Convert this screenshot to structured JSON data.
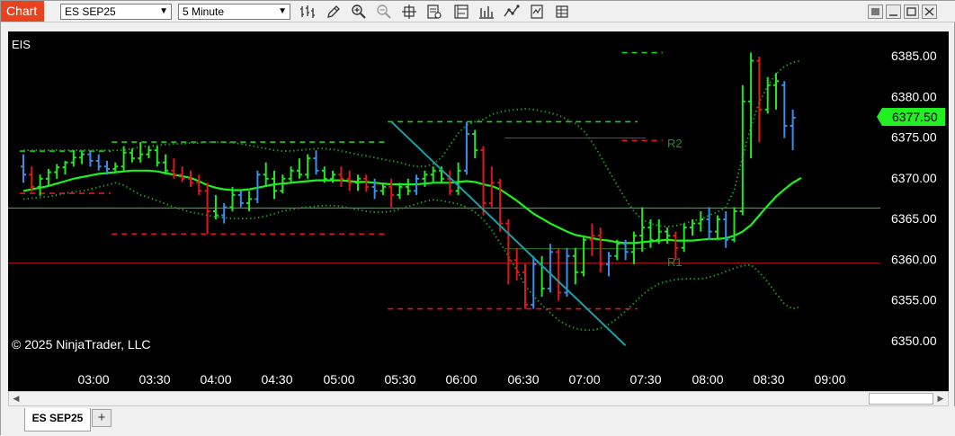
{
  "window": {
    "tag": "Chart",
    "instrument": "ES SEP25",
    "timeframe": "5 Minute"
  },
  "toolbar_icons": [
    "bar-style-icon",
    "draw-pencil-icon",
    "zoom-in-icon",
    "zoom-out-icon",
    "crosshair-icon",
    "data-box-icon",
    "strategies-icon",
    "indicators-icon",
    "chart-trader-icon",
    "properties-icon",
    "templates-icon"
  ],
  "chart": {
    "symbol_label": "EIS",
    "copyright": "© 2025 NinjaTrader, LLC",
    "level_labels": [
      "R2",
      "R1"
    ],
    "current_price": "6377.50",
    "price_ticks": [
      "6385.00",
      "6380.00",
      "6375.00",
      "6370.00",
      "6365.00",
      "6360.00",
      "6355.00",
      "6350.00"
    ],
    "time_ticks": [
      "03:00",
      "03:30",
      "04:00",
      "04:30",
      "05:00",
      "05:30",
      "06:00",
      "06:30",
      "07:00",
      "07:30",
      "08:00",
      "08:30",
      "09:00"
    ],
    "colors": {
      "up_bar": "#22e822",
      "down_bar": "#e01818",
      "neutral_bar": "#3a8eea",
      "sma": "#1ef01e",
      "band": "#1f8f1f",
      "trendline": "#1aa0a8",
      "price_box": "#22f022"
    }
  },
  "chart_data": {
    "type": "candlestick-ohlc",
    "title": "",
    "symbol": "ES SEP25",
    "interval": "5 Minute",
    "ylim": [
      6348,
      6388
    ],
    "y_ticks": [
      6350,
      6355,
      6360,
      6365,
      6370,
      6375,
      6380,
      6385
    ],
    "x_ticks": [
      "03:00",
      "03:30",
      "04:00",
      "04:30",
      "05:00",
      "05:30",
      "06:00",
      "06:30",
      "07:00",
      "07:30",
      "08:00",
      "08:30",
      "09:00"
    ],
    "bars": [
      [
        6371.4,
        6372.9,
        6369.4,
        6370.4,
        "n"
      ],
      [
        6370.4,
        6371.4,
        6368.3,
        6368.9,
        "d"
      ],
      [
        6368.9,
        6370.4,
        6367.8,
        6369.9,
        "u"
      ],
      [
        6369.9,
        6371.1,
        6369.1,
        6370.7,
        "u"
      ],
      [
        6370.7,
        6371.7,
        6369.9,
        6371.3,
        "u"
      ],
      [
        6371.3,
        6372.1,
        6370.4,
        6371.9,
        "u"
      ],
      [
        6371.9,
        6373.4,
        6371.4,
        6372.5,
        "u"
      ],
      [
        6372.5,
        6373.2,
        6371.7,
        6372.9,
        "u"
      ],
      [
        6372.9,
        6373.3,
        6371.4,
        6372.1,
        "n"
      ],
      [
        6372.1,
        6372.9,
        6370.9,
        6371.4,
        "n"
      ],
      [
        6371.4,
        6372.1,
        6370.4,
        6371.1,
        "n"
      ],
      [
        6371.1,
        6371.9,
        6370.6,
        6371.4,
        "u"
      ],
      [
        6371.4,
        6373.9,
        6370.9,
        6373.1,
        "u"
      ],
      [
        6373.1,
        6373.6,
        6371.9,
        6372.4,
        "u"
      ],
      [
        6372.4,
        6374.4,
        6371.9,
        6372.9,
        "u"
      ],
      [
        6372.9,
        6373.9,
        6372.4,
        6373.4,
        "u"
      ],
      [
        6373.4,
        6373.9,
        6371.4,
        6371.9,
        "u"
      ],
      [
        6371.9,
        6372.9,
        6370.4,
        6370.9,
        "u"
      ],
      [
        6370.9,
        6372.4,
        6369.9,
        6370.4,
        "d"
      ],
      [
        6370.4,
        6371.4,
        6369.5,
        6369.9,
        "d"
      ],
      [
        6369.9,
        6370.9,
        6368.9,
        6369.4,
        "d"
      ],
      [
        6369.4,
        6370.4,
        6367.9,
        6368.4,
        "d"
      ],
      [
        6368.4,
        6369.4,
        6363.1,
        6365.9,
        "d"
      ],
      [
        6365.9,
        6367.9,
        6364.9,
        6365.4,
        "u"
      ],
      [
        6365.4,
        6366.9,
        6364.4,
        6366.4,
        "n"
      ],
      [
        6366.4,
        6368.9,
        6365.9,
        6367.9,
        "u"
      ],
      [
        6367.9,
        6368.4,
        6366.4,
        6366.9,
        "n"
      ],
      [
        6366.9,
        6368.4,
        6365.9,
        6367.4,
        "u"
      ],
      [
        6367.4,
        6370.9,
        6366.9,
        6370.4,
        "n"
      ],
      [
        6370.4,
        6371.9,
        6368.9,
        6369.9,
        "u"
      ],
      [
        6369.9,
        6370.9,
        6367.4,
        6368.4,
        "u"
      ],
      [
        6368.4,
        6370.4,
        6368.1,
        6369.9,
        "u"
      ],
      [
        6369.9,
        6371.4,
        6369.4,
        6370.9,
        "u"
      ],
      [
        6370.9,
        6372.4,
        6369.9,
        6370.4,
        "u"
      ],
      [
        6370.4,
        6372.9,
        6369.9,
        6372.4,
        "u"
      ],
      [
        6372.4,
        6373.4,
        6370.4,
        6370.9,
        "n"
      ],
      [
        6370.9,
        6371.4,
        6369.4,
        6369.9,
        "u"
      ],
      [
        6369.9,
        6370.9,
        6369.4,
        6370.4,
        "u"
      ],
      [
        6370.4,
        6371.4,
        6368.9,
        6369.9,
        "d"
      ],
      [
        6369.9,
        6370.9,
        6368.4,
        6369.4,
        "d"
      ],
      [
        6369.4,
        6370.4,
        6368.4,
        6369.9,
        "u"
      ],
      [
        6369.9,
        6370.4,
        6368.3,
        6368.9,
        "d"
      ],
      [
        6368.9,
        6369.9,
        6367.4,
        6368.4,
        "n"
      ],
      [
        6368.4,
        6369.4,
        6367.9,
        6368.9,
        "u"
      ],
      [
        6368.9,
        6369.9,
        6366.4,
        6367.9,
        "d"
      ],
      [
        6367.9,
        6369.4,
        6367.4,
        6368.9,
        "u"
      ],
      [
        6368.9,
        6369.9,
        6367.9,
        6368.4,
        "u"
      ],
      [
        6368.4,
        6370.4,
        6367.9,
        6369.9,
        "n"
      ],
      [
        6369.9,
        6370.9,
        6368.9,
        6370.4,
        "u"
      ],
      [
        6370.4,
        6371.4,
        6369.4,
        6370.9,
        "u"
      ],
      [
        6370.9,
        6371.4,
        6369.4,
        6369.9,
        "u"
      ],
      [
        6369.9,
        6370.9,
        6367.9,
        6368.4,
        "d"
      ],
      [
        6368.4,
        6371.9,
        6367.9,
        6370.9,
        "u"
      ],
      [
        6370.9,
        6376.9,
        6370.4,
        6375.4,
        "n"
      ],
      [
        6375.4,
        6375.9,
        6372.4,
        6373.4,
        "u"
      ],
      [
        6373.4,
        6373.9,
        6365.4,
        6366.9,
        "d"
      ],
      [
        6366.9,
        6371.4,
        6366.4,
        6369.4,
        "d"
      ],
      [
        6369.4,
        6369.9,
        6363.4,
        6364.4,
        "d"
      ],
      [
        6364.4,
        6364.9,
        6356.9,
        6359.9,
        "d"
      ],
      [
        6359.9,
        6361.4,
        6357.4,
        6358.4,
        "d"
      ],
      [
        6358.4,
        6359.4,
        6353.9,
        6354.4,
        "d"
      ],
      [
        6354.4,
        6360.4,
        6353.9,
        6359.4,
        "n"
      ],
      [
        6359.4,
        6360.4,
        6355.4,
        6356.4,
        "u"
      ],
      [
        6356.4,
        6361.9,
        6355.9,
        6360.9,
        "n"
      ],
      [
        6360.9,
        6361.4,
        6354.9,
        6355.9,
        "d"
      ],
      [
        6355.9,
        6361.4,
        6355.4,
        6360.4,
        "n"
      ],
      [
        6360.4,
        6361.4,
        6356.9,
        6358.4,
        "u"
      ],
      [
        6358.4,
        6362.9,
        6357.9,
        6362.4,
        "u"
      ],
      [
        6362.4,
        6364.4,
        6360.4,
        6362.9,
        "d"
      ],
      [
        6362.9,
        6363.9,
        6358.4,
        6359.4,
        "d"
      ],
      [
        6359.4,
        6360.9,
        6357.9,
        6360.4,
        "n"
      ],
      [
        6360.4,
        6362.4,
        6359.9,
        6361.9,
        "u"
      ],
      [
        6361.9,
        6362.4,
        6359.9,
        6360.9,
        "n"
      ],
      [
        6360.9,
        6363.4,
        6359.4,
        6362.9,
        "u"
      ],
      [
        6362.9,
        6366.4,
        6360.9,
        6363.9,
        "u"
      ],
      [
        6363.9,
        6364.9,
        6361.4,
        6362.4,
        "u"
      ],
      [
        6362.4,
        6364.9,
        6361.9,
        6363.4,
        "u"
      ],
      [
        6363.4,
        6363.9,
        6361.9,
        6362.9,
        "u"
      ],
      [
        6362.9,
        6363.4,
        6359.9,
        6361.4,
        "d"
      ],
      [
        6361.4,
        6364.4,
        6360.9,
        6363.9,
        "u"
      ],
      [
        6363.9,
        6364.9,
        6362.9,
        6364.4,
        "u"
      ],
      [
        6364.4,
        6365.9,
        6363.4,
        6364.9,
        "u"
      ],
      [
        6364.9,
        6366.4,
        6362.4,
        6363.4,
        "n"
      ],
      [
        6363.4,
        6365.4,
        6362.4,
        6364.9,
        "u"
      ],
      [
        6364.9,
        6365.9,
        6361.4,
        6362.4,
        "n"
      ],
      [
        6362.4,
        6366.4,
        6362.1,
        6365.9,
        "u"
      ],
      [
        6365.9,
        6381.4,
        6365.4,
        6379.4,
        "u"
      ],
      [
        6379.4,
        6385.4,
        6372.4,
        6384.4,
        "u"
      ],
      [
        6384.4,
        6384.9,
        6374.4,
        6378.4,
        "d"
      ],
      [
        6378.4,
        6382.4,
        6377.9,
        6381.4,
        "u"
      ],
      [
        6381.4,
        6382.9,
        6378.4,
        6381.9,
        "u"
      ],
      [
        6381.4,
        6381.9,
        6374.9,
        6376.4,
        "n"
      ],
      [
        6376.4,
        6378.4,
        6373.4,
        6377.4,
        "n"
      ]
    ],
    "sma": [
      6368.4,
      6368.6,
      6368.8,
      6369.0,
      6369.3,
      6369.6,
      6369.9,
      6370.1,
      6370.3,
      6370.5,
      6370.6,
      6370.7,
      6370.8,
      6370.9,
      6370.9,
      6370.9,
      6370.8,
      6370.6,
      6370.4,
      6370.2,
      6370.0,
      6369.6,
      6369.1,
      6368.8,
      6368.6,
      6368.5,
      6368.5,
      6368.6,
      6368.8,
      6369.0,
      6369.2,
      6369.3,
      6369.4,
      6369.5,
      6369.6,
      6369.7,
      6369.7,
      6369.7,
      6369.7,
      6369.6,
      6369.5,
      6369.5,
      6369.4,
      6369.3,
      6369.2,
      6369.2,
      6369.2,
      6369.2,
      6369.3,
      6369.4,
      6369.4,
      6369.4,
      6369.5,
      6369.6,
      6369.5,
      6369.2,
      6369.0,
      6368.6,
      6367.9,
      6367.2,
      6366.4,
      6365.6,
      6365.0,
      6364.4,
      6363.9,
      6363.4,
      6363.0,
      6362.8,
      6362.6,
      6362.4,
      6362.3,
      6362.1,
      6362.0,
      6362.0,
      6362.1,
      6362.2,
      6362.3,
      6362.4,
      6362.3,
      6362.3,
      6362.3,
      6362.4,
      6362.5,
      6362.5,
      6362.6,
      6362.9,
      6363.4,
      6364.2,
      6365.4,
      6366.6,
      6367.7,
      6368.6,
      6369.4,
      6370.0
    ],
    "upper_band": [
      6373.4,
      6373.4,
      6373.4,
      6373.4,
      6373.4,
      6373.4,
      6373.4,
      6373.4,
      6373.4,
      6373.4,
      6373.4,
      6373.4,
      6373.4,
      6373.6,
      6373.8,
      6373.9,
      6374.0,
      6374.1,
      6374.2,
      6374.2,
      6374.3,
      6374.3,
      6374.4,
      6374.4,
      6374.4,
      6374.3,
      6374.2,
      6374.0,
      6373.8,
      6373.6,
      6373.4,
      6373.3,
      6373.3,
      6373.4,
      6373.5,
      6373.6,
      6373.6,
      6373.5,
      6373.3,
      6373.1,
      6372.9,
      6372.7,
      6372.5,
      6372.3,
      6372.1,
      6371.9,
      6371.6,
      6371.4,
      6371.4,
      6371.7,
      6372.5,
      6374.0,
      6375.5,
      6376.5,
      6376.9,
      6377.2,
      6377.8,
      6378.1,
      6378.3,
      6378.4,
      6378.5,
      6378.4,
      6378.2,
      6378.0,
      6377.7,
      6377.2,
      6376.7,
      6375.8,
      6374.4,
      6372.7,
      6370.9,
      6369.1,
      6367.4,
      6365.9,
      6364.9,
      6364.4,
      6364.1,
      6364.0,
      6364.1,
      6364.4,
      6364.7,
      6364.9,
      6365.4,
      6365.8,
      6366.4,
      6368.5,
      6372.6,
      6376.3,
      6379.3,
      6381.3,
      6382.8,
      6383.7,
      6384.2,
      6384.4
    ],
    "lower_band": [
      6367.4,
      6367.5,
      6367.6,
      6367.7,
      6367.9,
      6368.1,
      6368.3,
      6368.4,
      6368.6,
      6368.9,
      6369.1,
      6369.4,
      6369.1,
      6368.5,
      6367.9,
      6367.6,
      6367.2,
      6366.8,
      6366.4,
      6366.1,
      6365.8,
      6365.6,
      6365.4,
      6365.2,
      6365.1,
      6365.0,
      6365.0,
      6365.0,
      6365.1,
      6365.3,
      6365.6,
      6365.9,
      6366.1,
      6366.3,
      6366.4,
      6366.5,
      6366.6,
      6366.6,
      6366.5,
      6366.3,
      6366.1,
      6365.9,
      6365.8,
      6365.8,
      6365.9,
      6366.2,
      6366.5,
      6366.8,
      6367.1,
      6367.3,
      6367.2,
      6367.0,
      6366.8,
      6366.4,
      6365.8,
      6364.9,
      6363.6,
      6362.0,
      6360.4,
      6358.6,
      6356.8,
      6355.5,
      6354.4,
      6353.4,
      6352.5,
      6351.9,
      6351.5,
      6351.3,
      6351.3,
      6351.5,
      6352.0,
      6352.7,
      6353.6,
      6354.6,
      6355.6,
      6356.4,
      6357.0,
      6357.3,
      6357.5,
      6357.6,
      6357.6,
      6357.6,
      6357.8,
      6358.1,
      6358.5,
      6358.9,
      6359.2,
      6359.3,
      6358.4,
      6357.2,
      6355.8,
      6354.5,
      6353.9,
      6354.2
    ],
    "levels": [
      {
        "from": 0,
        "to": 10,
        "price": 6373.3,
        "style": "dashed",
        "color": "green"
      },
      {
        "from": 11,
        "to": 43,
        "price": 6374.4,
        "style": "dashed",
        "color": "green"
      },
      {
        "from": 0,
        "to": 10,
        "price": 6368.1,
        "style": "dashed",
        "color": "red"
      },
      {
        "from": 11,
        "to": 43,
        "price": 6363.1,
        "style": "dashed",
        "color": "red"
      },
      {
        "from": 44,
        "to": 73,
        "price": 6376.9,
        "style": "dashed",
        "color": "green"
      },
      {
        "from": 44,
        "to": 73,
        "price": 6353.9,
        "style": "dashed",
        "color": "red"
      },
      {
        "from": 72,
        "to": 76,
        "price": 6385.4,
        "style": "dashed",
        "color": "green"
      },
      {
        "from": 72,
        "to": 76,
        "price": 6374.6,
        "style": "dashed",
        "color": "red"
      },
      {
        "from": "all",
        "price": 6366.3,
        "style": "solid",
        "color": "green"
      },
      {
        "from": "all",
        "price": 6359.5,
        "style": "solid",
        "color": "red"
      },
      {
        "from": 58,
        "to": 74,
        "price": 6374.9,
        "style": "solid",
        "color": "darkgreen"
      },
      {
        "from": 58,
        "to": 74,
        "price": 6361.3,
        "style": "solid",
        "color": "darkgreen"
      }
    ],
    "trendline": [
      [
        44,
        6376.9
      ],
      [
        72,
        6349.4
      ]
    ],
    "last_price": 6377.5
  }
}
